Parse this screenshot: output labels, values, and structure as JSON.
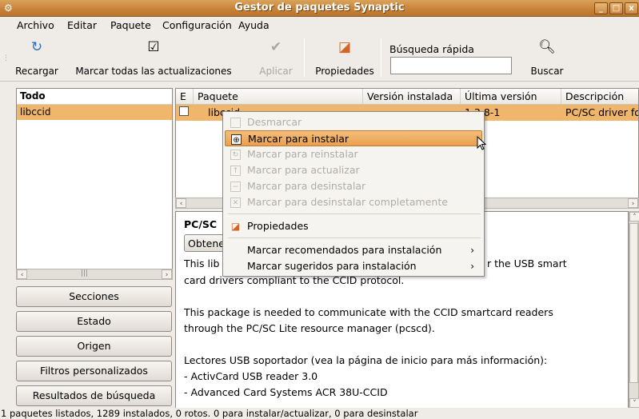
{
  "window": {
    "title": "Gestor de paquetes Synaptic",
    "controls": [
      "_",
      "□",
      "x"
    ]
  },
  "menubar": [
    "Archivo",
    "Editar",
    "Paquete",
    "Configuración",
    "Ayuda"
  ],
  "toolbar": {
    "reload": "Recargar",
    "mark_all": "Marcar todas las actualizaciones",
    "apply": "Aplicar",
    "properties": "Propiedades",
    "quick_search_label": "Búsqueda rápida",
    "quick_search_value": "",
    "search": "Buscar"
  },
  "filter_list": {
    "header": "Todo",
    "items": [
      "libccid"
    ]
  },
  "left_buttons": {
    "sections": "Secciones",
    "status": "Estado",
    "origin": "Origen",
    "custom_filters": "Filtros personalizados",
    "search_results": "Resultados de búsqueda"
  },
  "package_table": {
    "columns": [
      "E",
      "Paquete",
      "Versión instalada",
      "Última versión",
      "Descripción"
    ],
    "rows": [
      {
        "status": "",
        "name": "libccid",
        "installed": "",
        "latest": "1.3.8-1",
        "description": "PC/SC driver fo"
      }
    ]
  },
  "description_pane": {
    "title": "PC/SC",
    "button": "Obtene",
    "lines": [
      "This lib",
      "r the USB smart",
      "card drivers compliant to the CCID protocol.",
      "This package is needed to communicate with the CCID smartcard readers",
      "through the PC/SC Lite resource manager (pcscd).",
      "Lectores USB soportador (vea la página de inicio para más información):",
      " - ActivCard USB reader 3.0",
      " - Advanced Card Systems ACR 38U-CCID"
    ]
  },
  "context_menu": {
    "items": [
      {
        "label": "Desmarcar",
        "enabled": false
      },
      {
        "label": "Marcar para instalar",
        "enabled": true,
        "highlighted": true
      },
      {
        "label": "Marcar para reinstalar",
        "enabled": false
      },
      {
        "label": "Marcar para actualizar",
        "enabled": false
      },
      {
        "label": "Marcar para desinstalar",
        "enabled": false
      },
      {
        "label": "Marcar para desinstalar completamente",
        "enabled": false
      },
      {
        "label": "Propiedades",
        "enabled": true
      },
      {
        "label": "Marcar recomendados para instalación",
        "enabled": true
      },
      {
        "label": "Marcar sugeridos para instalación",
        "enabled": true
      }
    ]
  },
  "statusbar": "1 paquetes listados, 1289 instalados, 0 rotos. 0 para instalar/actualizar, 0 para desinstalar",
  "colors": {
    "titlebar": "#c9843a",
    "selection": "#efb66c",
    "menu_highlight": "#e9a04e"
  }
}
